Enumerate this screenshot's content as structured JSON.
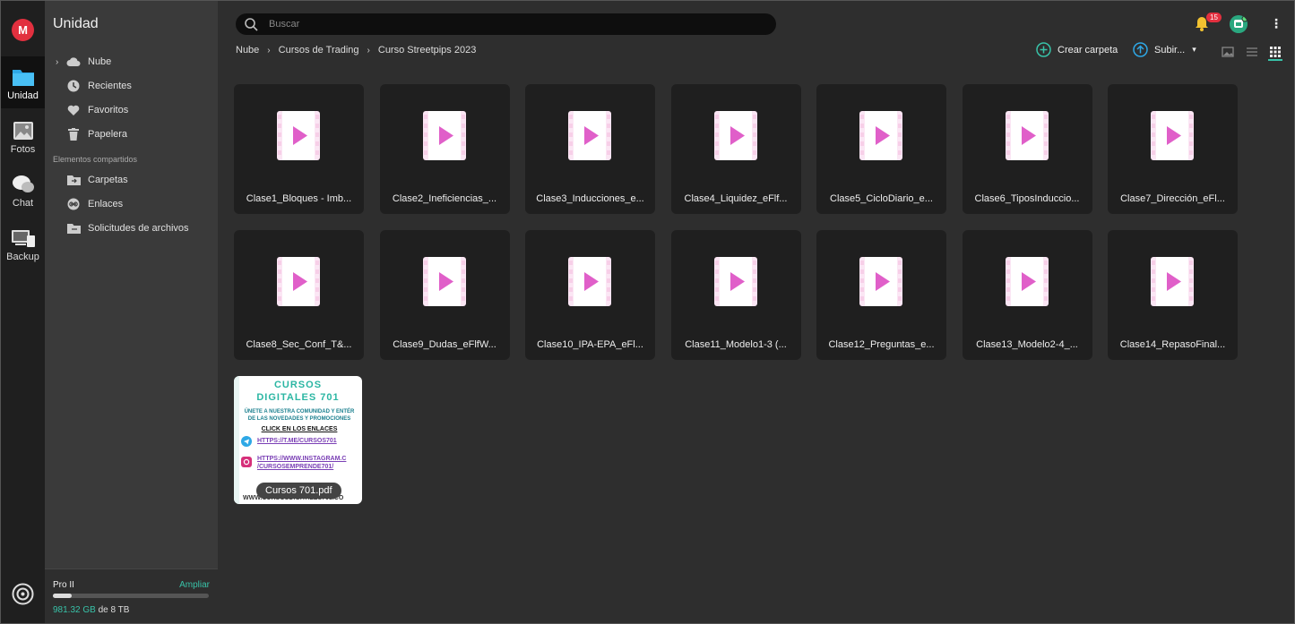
{
  "rail": {
    "logo": "M",
    "items": [
      {
        "label": "Unidad",
        "icon": "folder-icon"
      },
      {
        "label": "Fotos",
        "icon": "photos-icon"
      },
      {
        "label": "Chat",
        "icon": "chat-icon"
      },
      {
        "label": "Backup",
        "icon": "backup-icon"
      }
    ]
  },
  "sidebar": {
    "title": "Unidad",
    "items": [
      {
        "label": "Nube",
        "icon": "cloud-icon"
      },
      {
        "label": "Recientes",
        "icon": "clock-icon"
      },
      {
        "label": "Favoritos",
        "icon": "heart-icon"
      },
      {
        "label": "Papelera",
        "icon": "trash-icon"
      }
    ],
    "shared_label": "Elementos compartidos",
    "shared_items": [
      {
        "label": "Carpetas",
        "icon": "shared-folder-icon"
      },
      {
        "label": "Enlaces",
        "icon": "link-icon"
      },
      {
        "label": "Solicitudes de archivos",
        "icon": "file-request-icon"
      }
    ],
    "plan": {
      "name": "Pro II",
      "upgrade": "Ampliar",
      "used": "981.32 GB",
      "total": "de 8 TB",
      "usage_fraction": 0.12
    }
  },
  "header": {
    "search_placeholder": "Buscar",
    "notifications": "15"
  },
  "breadcrumb": [
    "Nube",
    "Cursos de Trading",
    "Curso Streetpips 2023"
  ],
  "toolbar": {
    "create_folder": "Crear carpeta",
    "upload": "Subir..."
  },
  "files": [
    "Clase1_Bloques - Imb...",
    "Clase2_Ineficiencias_...",
    "Clase3_Inducciones_e...",
    "Clase4_Liquidez_eFlf...",
    "Clase5_CicloDiario_e...",
    "Clase6_TiposInduccio...",
    "Clase7_Dirección_eFl...",
    "Clase8_Sec_Conf_T&...",
    "Clase9_Dudas_eFlfW...",
    "Clase10_IPA-EPA_eFl...",
    "Clase11_Modelo1-3 (...",
    "Clase12_Preguntas_e...",
    "Clase13_Modelo2-4_...",
    "Clase14_RepasoFinal..."
  ],
  "pdf": {
    "name": "Cursos 701.pdf",
    "title1": "CURSOS",
    "title2": "DIGITALES 701",
    "line1": "ÚNETE A NUESTRA COMUNIDAD Y ENTÉR",
    "line2": "DE LAS NOVEDADES Y PROMOCIONES",
    "cta": "CLICK EN LOS ENLACES",
    "link1": "HTTPS://T.ME/CURSOS701",
    "link2a": "HTTPS://WWW.INSTAGRAM.C",
    "link2b": "/CURSOSEMPRENDE701/",
    "footer": "WWW.CURSOSDIGITALES701.CO"
  }
}
